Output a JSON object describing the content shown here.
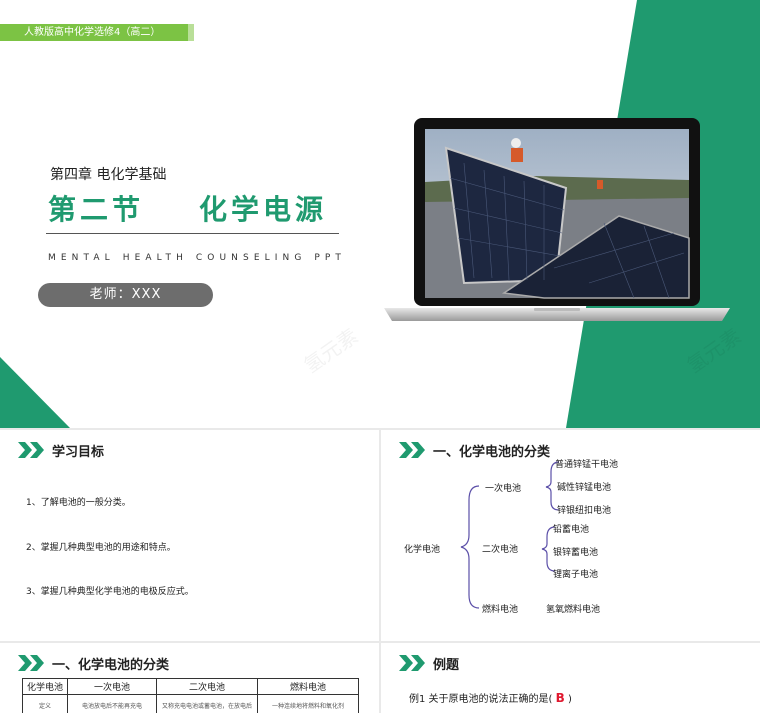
{
  "main": {
    "tag": "人教版高中化学选修4（高二）",
    "chapter": "第四章 电化学基础",
    "section_title": "第二节    化学电源",
    "subtitle_en": "MENTAL HEALTH COUNSELING PPT",
    "teacher": "老师：XXX",
    "watermark": "氢元素",
    "colors": {
      "accent": "#1f9a6f",
      "tag": "#7cc344",
      "pill": "#6d6d6d"
    }
  },
  "goals": {
    "heading": "学习目标",
    "items": [
      "1、了解电池的一般分类。",
      "2、掌握几种典型电池的用途和特点。",
      "3、掌握几种典型化学电池的电极反应式。"
    ]
  },
  "classification": {
    "heading": "一、化学电池的分类",
    "root": "化学电池",
    "primary": {
      "label": "一次电池",
      "items": [
        "普通锌锰干电池",
        "碱性锌锰电池",
        "锌银纽扣电池"
      ]
    },
    "secondary": {
      "label": "二次电池",
      "items": [
        "铅蓄电池",
        "银锌蓄电池",
        "锂离子电池"
      ]
    },
    "fuel": {
      "label": "燃料电池",
      "items": [
        "氢氧燃料电池"
      ]
    }
  },
  "table_slide": {
    "heading": "一、化学电池的分类",
    "headers": [
      "化学电池",
      "一次电池",
      "二次电池",
      "燃料电池"
    ],
    "row_partial": [
      "定义",
      "电池放电后不能再充电",
      "又称充电电池或蓄电池，在放电后",
      "一种连续地将燃料和氧化剂"
    ]
  },
  "example": {
    "heading": "例题",
    "question": "例1 关于原电池的说法正确的是(",
    "answer": "B",
    "question_end": ")"
  }
}
